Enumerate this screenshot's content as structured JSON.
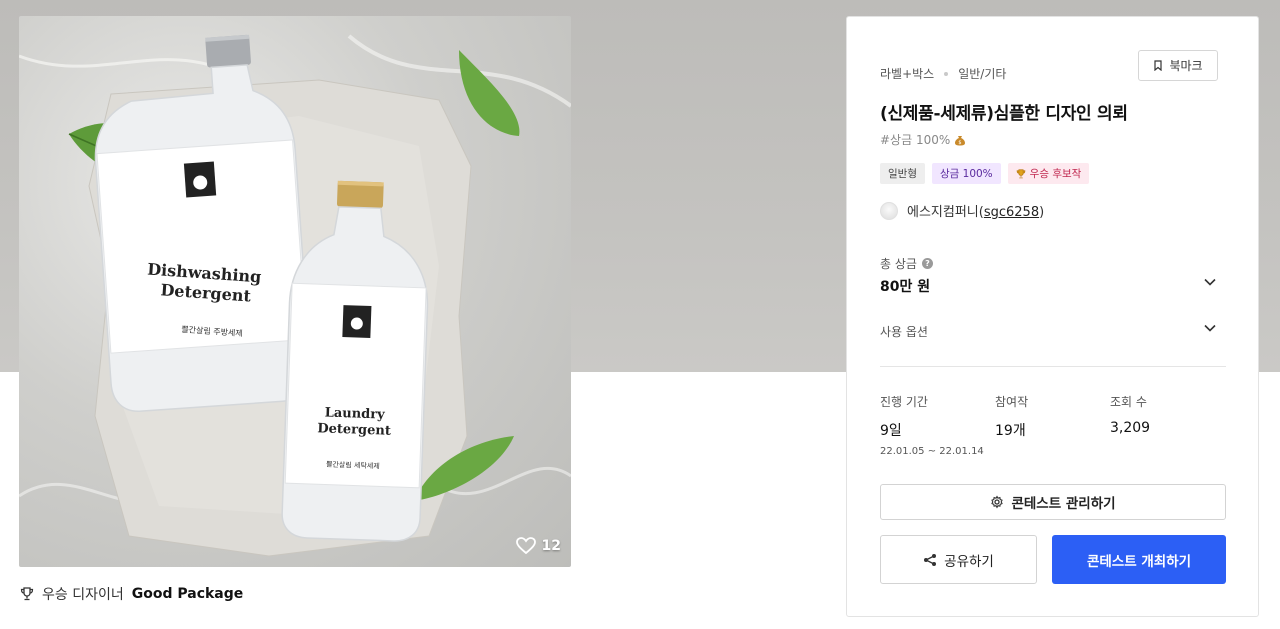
{
  "hero": {
    "like_count": "12",
    "bottle_large": {
      "title_line1": "Dishwashing",
      "title_line2": "Detergent",
      "korean_label": "쁠간살림 주방세제"
    },
    "bottle_small": {
      "title_line1": "Laundry",
      "title_line2": "Detergent",
      "korean_label": "쁠간살림 세탁세제"
    }
  },
  "designer": {
    "prefix": "우승 디자이너",
    "name": "Good Package"
  },
  "card": {
    "breadcrumb": [
      "라벨+박스",
      "일반/기타"
    ],
    "bookmark_label": "북마크",
    "title": "(신제품-세제류)심플한 디자인 의뢰",
    "hashtag": "#상금 100%",
    "tags": [
      {
        "label": "일반형"
      },
      {
        "label": "상금 100%"
      },
      {
        "label": "우승 후보작"
      }
    ],
    "company": {
      "name": "에스지컴퍼니",
      "handle": "sgc6258"
    },
    "total_prize": {
      "label": "총 상금",
      "value": "80만 원"
    },
    "usage_option": {
      "label": "사용 옵션"
    },
    "stats": {
      "period": {
        "label": "진행 기간",
        "value": "9일",
        "range": "22.01.05 ~ 22.01.14"
      },
      "entries": {
        "label": "참여작",
        "value": "19개"
      },
      "views": {
        "label": "조회 수",
        "value": "3,209"
      }
    },
    "buttons": {
      "manage": "콘테스트 관리하기",
      "share": "공유하기",
      "open": "콘테스트 개최하기"
    }
  },
  "colors": {
    "primary": "#2c5ff5",
    "prize_tag_bg": "#f1e6ff",
    "award_tag_bg": "#fde9ef"
  }
}
